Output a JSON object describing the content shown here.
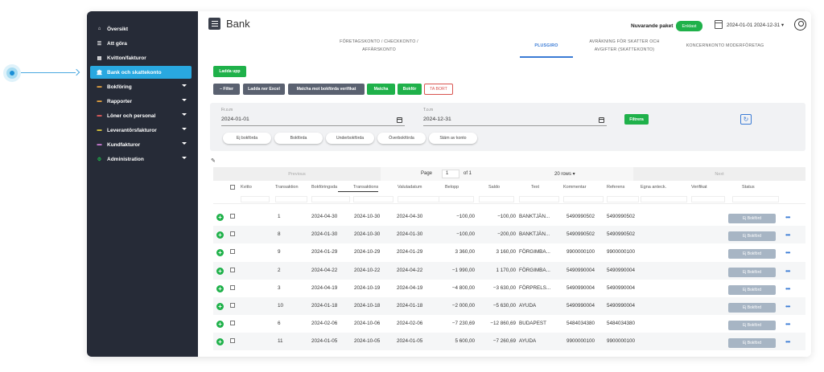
{
  "sidebar": {
    "items": [
      {
        "label": "Översikt",
        "icon": "home-icon",
        "glyph": "⌂"
      },
      {
        "label": "Att göra",
        "icon": "checklist-icon",
        "glyph": "☰"
      },
      {
        "label": "Kvitton/fakturor",
        "icon": "receipt-icon",
        "glyph": "▤"
      },
      {
        "label": "Bank och skattekonto",
        "icon": "bank-icon",
        "glyph": "🏛",
        "active": true
      },
      {
        "label": "Bokföring",
        "icon": "ledger-icon",
        "glyph": "▬",
        "expandable": true
      },
      {
        "label": "Rapporter",
        "icon": "report-icon",
        "glyph": "▬",
        "expandable": true
      },
      {
        "label": "Löner och personal",
        "icon": "payroll-icon",
        "glyph": "▬",
        "expandable": true
      },
      {
        "label": "Leverantörsfakturor",
        "icon": "supplier-invoice-icon",
        "glyph": "▬",
        "expandable": true
      },
      {
        "label": "Kundfakturor",
        "icon": "customer-invoice-icon",
        "glyph": "▬",
        "expandable": true
      },
      {
        "label": "Administration",
        "icon": "admin-icon",
        "glyph": "⚙",
        "expandable": true
      }
    ]
  },
  "header": {
    "title": "Bank",
    "plan_label": "Nuvarande paket",
    "plan_badge": "Enklast",
    "date_range": "2024-01-01 2024-12-31 ▾"
  },
  "tabs": [
    {
      "line1": "FÖRETAGSKONTO / CHECKKONTO /",
      "line2": "AFFÄRSKONTO"
    },
    {
      "line1": "PLUSGIRO",
      "line2": "",
      "active": true
    },
    {
      "line1": "AVRÄKNING FÖR SKATTER OCH",
      "line2": "AVGIFTER (SKATTEKONTO)"
    },
    {
      "line1": "KONCERNKONTO MODERFÖRETAG",
      "line2": ""
    }
  ],
  "actions": {
    "upload": "Ladda upp",
    "filter": "− Filter",
    "download_excel": "Ladda ner Excel",
    "match_verification": "Matcha mot bokförda verifikat",
    "match": "Matcha",
    "book": "Bokför",
    "delete": "TA BORT"
  },
  "filters": {
    "from_label": "Fr.o.m",
    "from_value": "2024-01-01",
    "to_label": "T.o.m",
    "to_value": "2024-12-31",
    "apply": "Filtrera",
    "refresh_glyph": "↻",
    "pills": [
      "Ej bokförda",
      "Bokförda",
      "Underbokförda",
      "Överbokförda",
      "Stäm av konto"
    ]
  },
  "pager": {
    "previous": "Previous",
    "page_label": "Page",
    "page_value": "1",
    "of_label": "of 1",
    "rows": "20 rows ▾",
    "next": "Next"
  },
  "columns": [
    "Kvitto",
    "Transaktion",
    "Bokföringsda",
    "Transaktions",
    "Valutadatum",
    "Belopp",
    "Saldo",
    "Text",
    "Kommentar",
    "Referens",
    "Egna anteck.",
    "Verifikat",
    "Status"
  ],
  "rows": [
    {
      "transaction": "1",
      "booking": "2024-04-30",
      "trans_date": "2024-10-30",
      "value_date": "2024-04-30",
      "amount": "−100,00",
      "balance": "−100,00",
      "text": "BANKTJÄN...",
      "comment": "5490990502",
      "reference": "5490990502",
      "status": "Ej Bokförd"
    },
    {
      "transaction": "8",
      "booking": "2024-01-30",
      "trans_date": "2024-10-30",
      "value_date": "2024-01-30",
      "amount": "−100,00",
      "balance": "−200,00",
      "text": "BANKTJÄN...",
      "comment": "5490990502",
      "reference": "5490990502",
      "status": "Ej Bokförd"
    },
    {
      "transaction": "9",
      "booking": "2024-01-29",
      "trans_date": "2024-10-29",
      "value_date": "2024-01-29",
      "amount": "3 360,00",
      "balance": "3 160,00",
      "text": "FÖRGIMBA...",
      "comment": "9900000100",
      "reference": "9900000100",
      "status": "Ej Bokförd"
    },
    {
      "transaction": "2",
      "booking": "2024-04-22",
      "trans_date": "2024-10-22",
      "value_date": "2024-04-22",
      "amount": "−1 990,00",
      "balance": "1 170,00",
      "text": "FÖRGIMBA...",
      "comment": "5490990004",
      "reference": "5490990004",
      "status": "Ej Bokförd"
    },
    {
      "transaction": "3",
      "booking": "2024-04-19",
      "trans_date": "2024-10-19",
      "value_date": "2024-04-19",
      "amount": "−4 800,00",
      "balance": "−3 630,00",
      "text": "FÖRPRELS...",
      "comment": "5490990004",
      "reference": "5490990004",
      "status": "Ej Bokförd"
    },
    {
      "transaction": "10",
      "booking": "2024-01-18",
      "trans_date": "2024-10-18",
      "value_date": "2024-01-18",
      "amount": "−2 000,00",
      "balance": "−5 630,00",
      "text": "AYUDA",
      "comment": "5490990004",
      "reference": "5490990004",
      "status": "Ej Bokförd"
    },
    {
      "transaction": "6",
      "booking": "2024-02-06",
      "trans_date": "2024-10-06",
      "value_date": "2024-02-06",
      "amount": "−7 230,69",
      "balance": "−12 860,69",
      "text": "BUDAPEST",
      "comment": "5484034380",
      "reference": "5484034380",
      "status": "Ej Bokförd"
    },
    {
      "transaction": "11",
      "booking": "2024-01-05",
      "trans_date": "2024-10-05",
      "value_date": "2024-01-05",
      "amount": "5 600,00",
      "balance": "−7 260,69",
      "text": "AYUDA",
      "comment": "9900000100",
      "reference": "9900000100",
      "status": "Ej Bokförd"
    }
  ],
  "colors": {
    "sidebar": "#262b37",
    "active": "#29a8e0",
    "green": "#1fb14a",
    "status": "#a7b5c4",
    "accent": "#3a7bd5"
  }
}
